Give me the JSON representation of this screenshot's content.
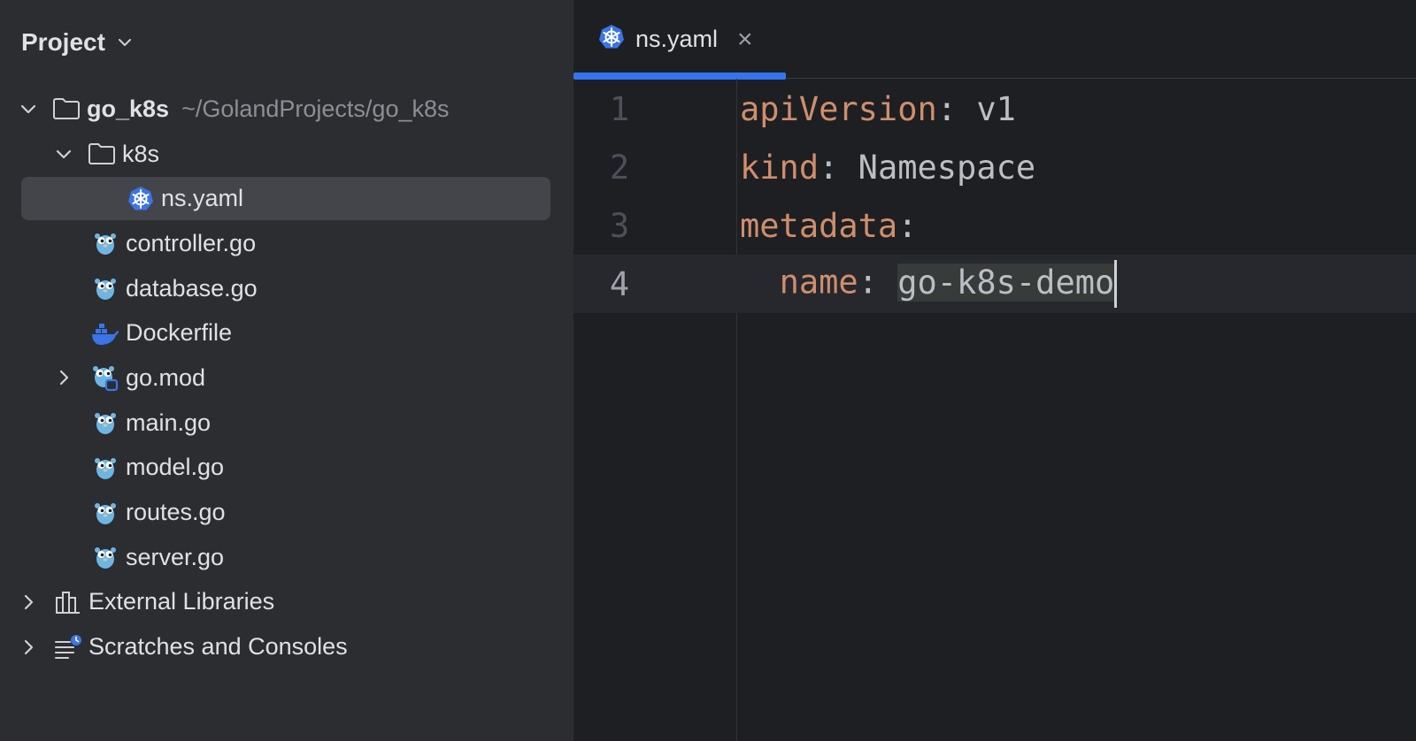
{
  "project_panel": {
    "title": "Project",
    "root": {
      "name": "go_k8s",
      "path": "~/GolandProjects/go_k8s"
    },
    "k8s_folder": "k8s",
    "items": [
      {
        "label": "ns.yaml",
        "icon": "kubernetes-icon"
      },
      {
        "label": "controller.go",
        "icon": "gopher-icon"
      },
      {
        "label": "database.go",
        "icon": "gopher-icon"
      },
      {
        "label": "Dockerfile",
        "icon": "docker-icon"
      },
      {
        "label": "go.mod",
        "icon": "gomod-icon"
      },
      {
        "label": "main.go",
        "icon": "gopher-icon"
      },
      {
        "label": "model.go",
        "icon": "gopher-icon"
      },
      {
        "label": "routes.go",
        "icon": "gopher-icon"
      },
      {
        "label": "server.go",
        "icon": "gopher-icon"
      }
    ],
    "external_libraries": "External Libraries",
    "scratches": "Scratches and Consoles"
  },
  "editor": {
    "tab": {
      "label": "ns.yaml",
      "close": "×"
    },
    "lines": [
      {
        "num": "1",
        "key": "apiVersion",
        "colon": ":",
        "value": " v1"
      },
      {
        "num": "2",
        "key": "kind",
        "colon": ":",
        "value": " Namespace"
      },
      {
        "num": "3",
        "key": "metadata",
        "colon": ":",
        "value": ""
      },
      {
        "num": "4",
        "indent": "  ",
        "key": "name",
        "colon": ":",
        "space": " ",
        "value": "go-k8s-demo"
      }
    ]
  },
  "colors": {
    "accent": "#3574f0",
    "yaml_key": "#cf8e6d",
    "panel_bg": "#2b2d30",
    "editor_bg": "#1e1f22"
  }
}
